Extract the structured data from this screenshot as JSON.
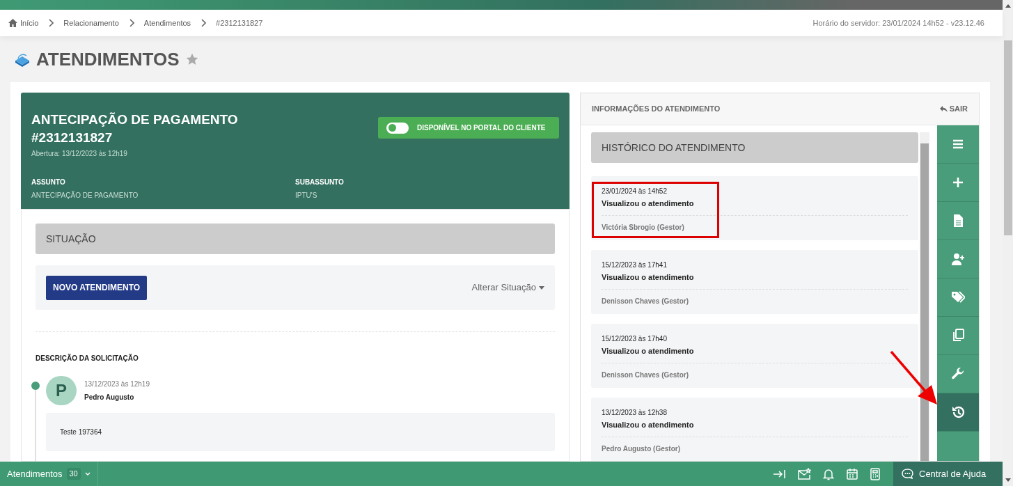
{
  "breadcrumb": {
    "items": [
      {
        "label": "Início"
      },
      {
        "label": "Relacionamento"
      },
      {
        "label": "Atendimentos"
      },
      {
        "label": "#2312131827"
      }
    ],
    "server_time": "Horário do servidor: 23/01/2024 14h52 - v23.12.46"
  },
  "page_title": "ATENDIMENTOS",
  "favorite": false,
  "ticket": {
    "title": "ANTECIPAÇÃO DE PAGAMENTO #2312131827",
    "opened": "Abertura: 13/12/2023 às 12h19",
    "portal_toggle": {
      "label": "DISPONÍVEL NO PORTAL DO CLIENTE",
      "on": false
    },
    "fields": [
      {
        "label": "ASSUNTO",
        "value": "ANTECIPAÇÃO DE PAGAMENTO"
      },
      {
        "label": "SUBASSUNTO",
        "value": "IPTU'S"
      }
    ]
  },
  "situation": {
    "heading": "SITUAÇÃO",
    "button": "NOVO ATENDIMENTO",
    "menu": "Alterar Situação"
  },
  "description": {
    "heading": "DESCRIÇÃO DA SOLICITAÇÃO",
    "entries": [
      {
        "avatar_letter": "P",
        "date": "13/12/2023 às 12h19",
        "author": "Pedro Augusto",
        "message": "Teste 197364"
      }
    ]
  },
  "info_panel": {
    "title": "INFORMAÇÕES DO ATENDIMENTO",
    "exit": "SAIR",
    "history": {
      "heading": "HISTÓRICO DO ATENDIMENTO",
      "entries": [
        {
          "date": "23/01/2024 às 14h52",
          "action": "Visualizou o atendimento",
          "user": "Victória Sbrogio (Gestor)",
          "highlighted": true
        },
        {
          "date": "15/12/2023 às 17h41",
          "action": "Visualizou o atendimento",
          "user": "Denisson Chaves (Gestor)",
          "highlighted": false
        },
        {
          "date": "15/12/2023 às 17h40",
          "action": "Visualizou o atendimento",
          "user": "Denisson Chaves (Gestor)",
          "highlighted": false
        },
        {
          "date": "13/12/2023 às 12h38",
          "action": "Visualizou o atendimento",
          "user": "Pedro Augusto (Gestor)",
          "highlighted": false
        }
      ]
    },
    "tools": [
      {
        "kind": "menu",
        "selected": false
      },
      {
        "kind": "add",
        "selected": false
      },
      {
        "kind": "document",
        "selected": false
      },
      {
        "kind": "add-user",
        "selected": false
      },
      {
        "kind": "tags",
        "selected": false
      },
      {
        "kind": "copy",
        "selected": false
      },
      {
        "kind": "wrench",
        "selected": false
      },
      {
        "kind": "history",
        "selected": true
      }
    ]
  },
  "bottom_bar": {
    "label": "Atendimentos",
    "count": "30",
    "help": "Central de Ajuda"
  }
}
